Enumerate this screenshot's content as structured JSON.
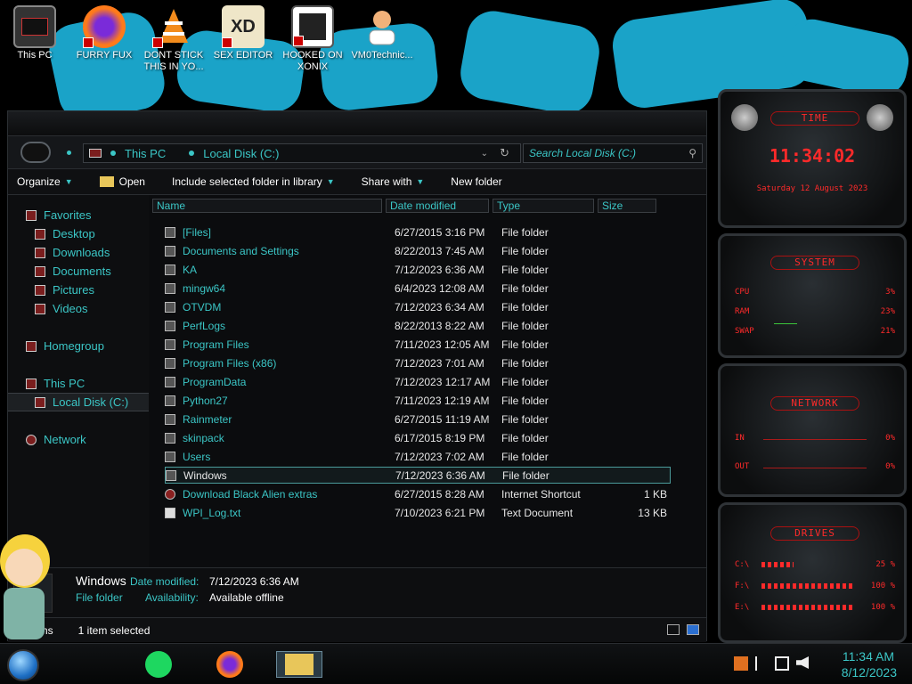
{
  "desktop_icons": [
    {
      "label": "This PC",
      "icon": "computer-icon"
    },
    {
      "label": "FURRY FUX",
      "icon": "firefox-icon"
    },
    {
      "label": "DONT STICK THIS IN YO...",
      "icon": "vlc-icon"
    },
    {
      "label": "SEX EDITOR",
      "icon": "hex-editor-icon"
    },
    {
      "label": "HOOKED ON XONIX",
      "icon": "game-icon"
    },
    {
      "label": "VM0Technic...",
      "icon": "user-doctor-icon"
    }
  ],
  "address": {
    "segments": [
      "This PC",
      "Local Disk (C:)"
    ],
    "search_placeholder": "Search Local Disk (C:)"
  },
  "toolbar": {
    "organize": "Organize",
    "open": "Open",
    "include": "Include selected folder in library",
    "share": "Share with",
    "new_folder": "New folder"
  },
  "navpane": {
    "favorites": "Favorites",
    "favorites_items": [
      "Desktop",
      "Downloads",
      "Documents",
      "Pictures",
      "Videos"
    ],
    "homegroup": "Homegroup",
    "thispc": "This PC",
    "localdisk": "Local Disk (C:)",
    "network": "Network"
  },
  "columns": {
    "name": "Name",
    "date": "Date modified",
    "type": "Type",
    "size": "Size"
  },
  "files": [
    {
      "name": "[Files]",
      "date": "6/27/2015 3:16 PM",
      "type": "File folder",
      "size": ""
    },
    {
      "name": "Documents and Settings",
      "date": "8/22/2013 7:45 AM",
      "type": "File folder",
      "size": ""
    },
    {
      "name": "KA",
      "date": "7/12/2023 6:36 AM",
      "type": "File folder",
      "size": ""
    },
    {
      "name": "mingw64",
      "date": "6/4/2023 12:08 AM",
      "type": "File folder",
      "size": ""
    },
    {
      "name": "OTVDM",
      "date": "7/12/2023 6:34 AM",
      "type": "File folder",
      "size": ""
    },
    {
      "name": "PerfLogs",
      "date": "8/22/2013 8:22 AM",
      "type": "File folder",
      "size": ""
    },
    {
      "name": "Program Files",
      "date": "7/11/2023 12:05 AM",
      "type": "File folder",
      "size": ""
    },
    {
      "name": "Program Files (x86)",
      "date": "7/12/2023 7:01 AM",
      "type": "File folder",
      "size": ""
    },
    {
      "name": "ProgramData",
      "date": "7/12/2023 12:17 AM",
      "type": "File folder",
      "size": ""
    },
    {
      "name": "Python27",
      "date": "7/11/2023 12:19 AM",
      "type": "File folder",
      "size": ""
    },
    {
      "name": "Rainmeter",
      "date": "6/27/2015 11:19 AM",
      "type": "File folder",
      "size": ""
    },
    {
      "name": "skinpack",
      "date": "6/17/2015 8:19 PM",
      "type": "File folder",
      "size": ""
    },
    {
      "name": "Users",
      "date": "7/12/2023 7:02 AM",
      "type": "File folder",
      "size": ""
    },
    {
      "name": "Windows",
      "date": "7/12/2023 6:36 AM",
      "type": "File folder",
      "size": "",
      "selected": true
    },
    {
      "name": "Download Black Alien extras",
      "date": "6/27/2015 8:28 AM",
      "type": "Internet Shortcut",
      "size": "1 KB"
    },
    {
      "name": "WPI_Log.txt",
      "date": "7/10/2023 6:21 PM",
      "type": "Text Document",
      "size": "13 KB"
    }
  ],
  "details": {
    "name": "Windows",
    "type": "File folder",
    "date_label": "Date modified:",
    "date_value": "7/12/2023 6:36 AM",
    "avail_label": "Availability:",
    "avail_value": "Available offline"
  },
  "status": {
    "items": "items",
    "selected": "1 item selected"
  },
  "widgets": {
    "time": {
      "title": "Time",
      "clock": "11:34:02",
      "date": "Saturday 12 August 2023"
    },
    "system": {
      "title": "System",
      "rows": [
        {
          "label": "CPU",
          "value": "3%"
        },
        {
          "label": "RAM",
          "value": "23%"
        },
        {
          "label": "SWAP",
          "value": "21%"
        }
      ]
    },
    "network": {
      "title": "Network",
      "rows": [
        {
          "label": "IN",
          "value": "0%"
        },
        {
          "label": "OUT",
          "value": "0%"
        }
      ]
    },
    "drives": {
      "title": "Drives",
      "rows": [
        {
          "label": "C:\\",
          "value": "25 %"
        },
        {
          "label": "F:\\",
          "value": "100 %"
        },
        {
          "label": "E:\\",
          "value": "100 %"
        }
      ]
    }
  },
  "taskbar": {
    "time": "11:34 AM",
    "date": "8/12/2023"
  },
  "colors": {
    "accent": "#3bc6c6",
    "widget_red": "#ff2a2a",
    "brush_blue": "#1aa3c8"
  }
}
